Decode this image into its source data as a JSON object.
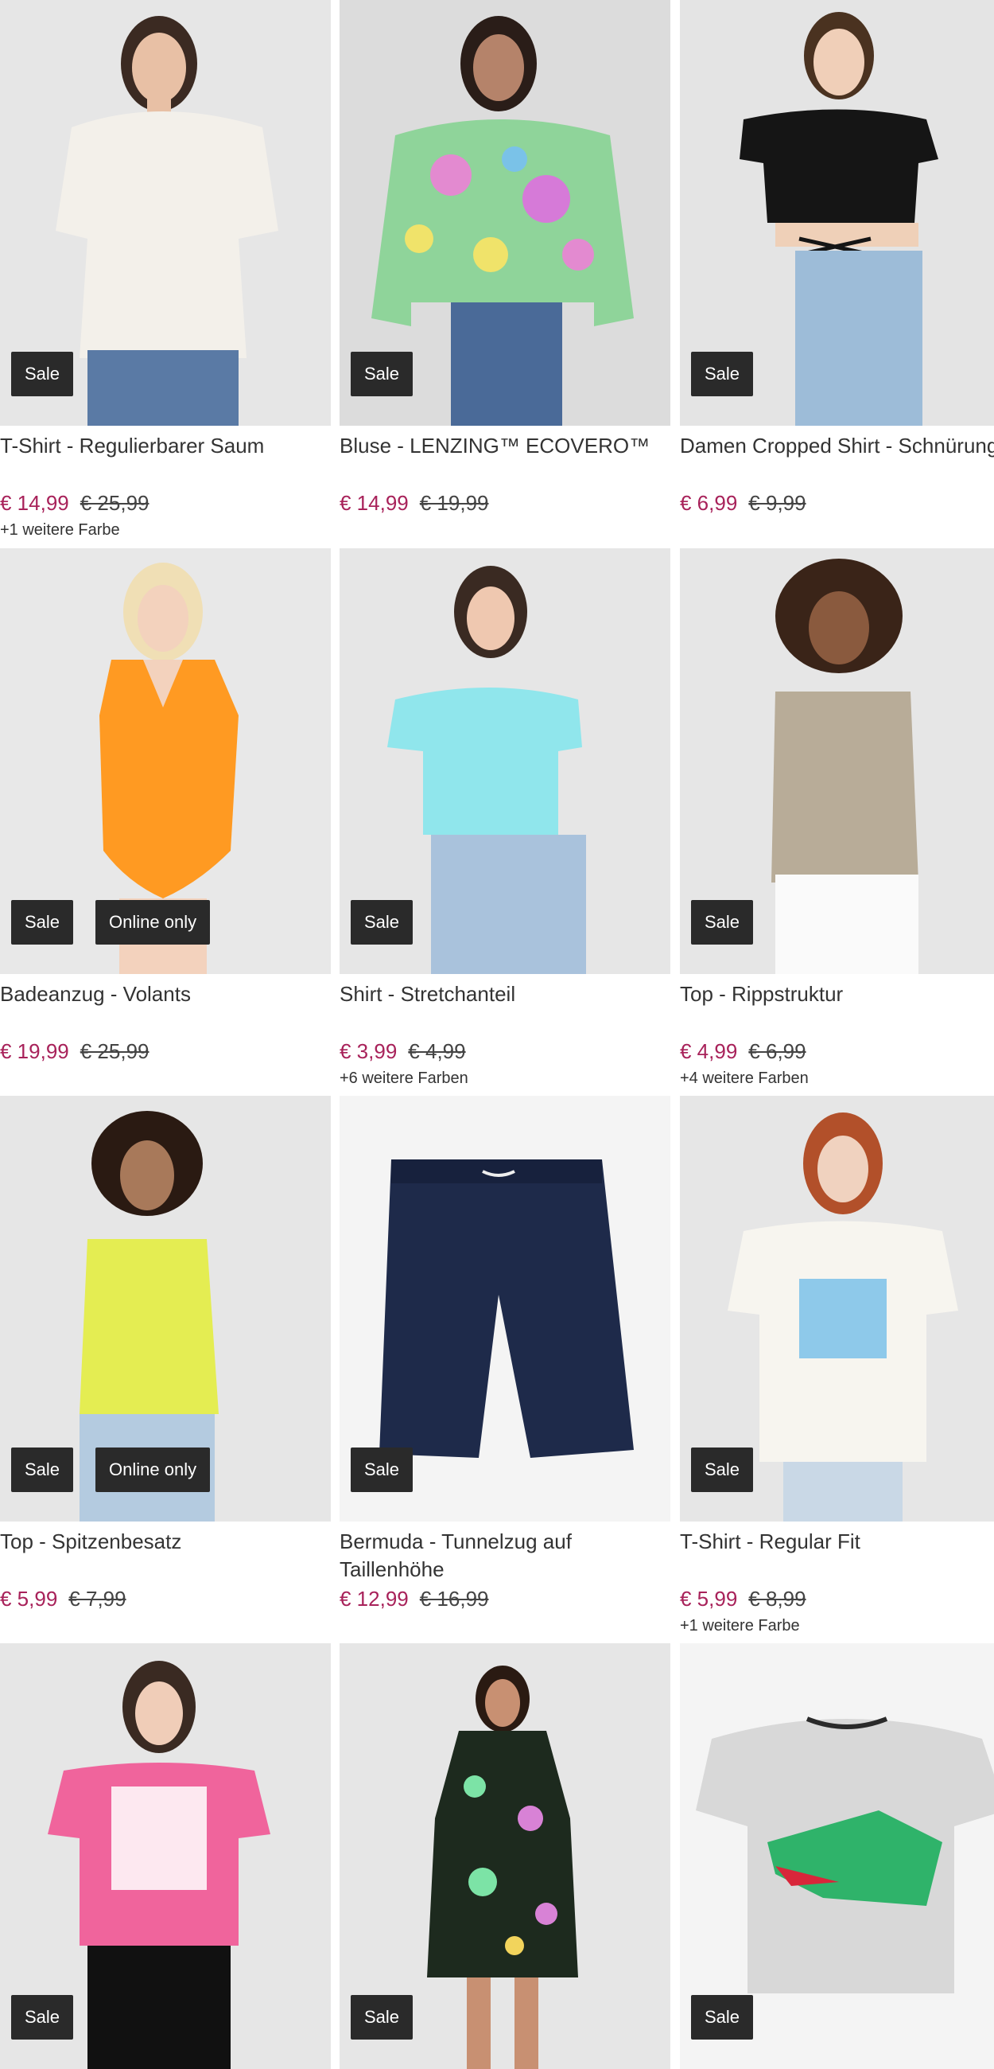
{
  "badges": {
    "sale": "Sale",
    "online_only": "Online only"
  },
  "products": [
    {
      "title": "T-Shirt - Regulierbarer Saum",
      "price": "€ 14,99",
      "old_price": "€ 25,99",
      "colors": "+1 weitere Farbe",
      "badges": [
        "Sale"
      ],
      "image": "white-top-icon"
    },
    {
      "title": "Bluse - LENZING™ ECOVERO™",
      "price": "€ 14,99",
      "old_price": "€ 19,99",
      "colors": "",
      "badges": [
        "Sale"
      ],
      "image": "floral-blouse-icon"
    },
    {
      "title": "Damen Cropped Shirt - Schnürung",
      "price": "€ 6,99",
      "old_price": "€ 9,99",
      "colors": "",
      "badges": [
        "Sale"
      ],
      "image": "black-crop-icon"
    },
    {
      "title": "Badeanzug - Volants",
      "price": "€ 19,99",
      "old_price": "€ 25,99",
      "colors": "",
      "badges": [
        "Sale",
        "Online only"
      ],
      "image": "swimsuit-icon"
    },
    {
      "title": "Shirt - Stretchanteil",
      "price": "€ 3,99",
      "old_price": "€ 4,99",
      "colors": "+6 weitere Farben",
      "badges": [
        "Sale"
      ],
      "image": "turquoise-shirt-icon"
    },
    {
      "title": "Top - Rippstruktur",
      "price": "€ 4,99",
      "old_price": "€ 6,99",
      "colors": "+4 weitere Farben",
      "badges": [
        "Sale"
      ],
      "image": "beige-top-icon"
    },
    {
      "title": "Top - Spitzenbesatz",
      "price": "€ 5,99",
      "old_price": "€ 7,99",
      "colors": "",
      "badges": [
        "Sale",
        "Online only"
      ],
      "image": "yellow-top-icon"
    },
    {
      "title": "Bermuda - Tunnelzug auf Taillenhöhe",
      "price": "€ 12,99",
      "old_price": "€ 16,99",
      "colors": "",
      "badges": [
        "Sale"
      ],
      "image": "navy-shorts-icon"
    },
    {
      "title": "T-Shirt - Regular Fit",
      "price": "€ 5,99",
      "old_price": "€ 8,99",
      "colors": "+1 weitere Farbe",
      "badges": [
        "Sale"
      ],
      "image": "print-tshirt-icon"
    },
    {
      "title": "",
      "price": "",
      "old_price": "",
      "colors": "",
      "badges": [
        "Sale"
      ],
      "image": "pink-tshirt-icon"
    },
    {
      "title": "",
      "price": "",
      "old_price": "",
      "colors": "",
      "badges": [
        "Sale"
      ],
      "image": "floral-dress-icon"
    },
    {
      "title": "",
      "price": "",
      "old_price": "",
      "colors": "",
      "badges": [
        "Sale"
      ],
      "image": "crocodile-tshirt-icon"
    }
  ],
  "colors": {
    "sale_price": "#a8225a",
    "badge_bg": "#2a2a2a"
  }
}
